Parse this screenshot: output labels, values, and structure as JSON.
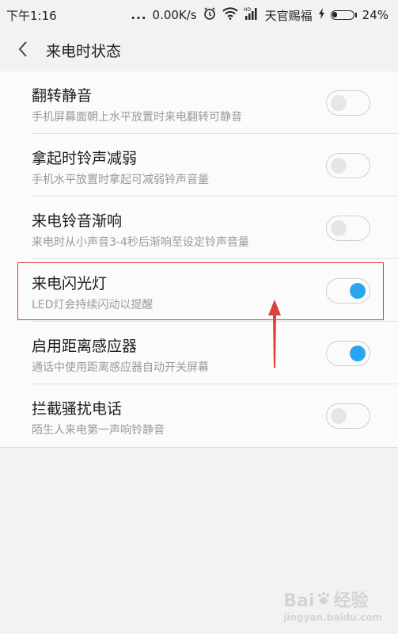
{
  "status_bar": {
    "time": "下午1:16",
    "dots": "...",
    "network_speed": "0.00K/s",
    "carrier": "天官赐福",
    "battery_percent": "24%",
    "icons": [
      "alarm-icon",
      "wifi-icon",
      "hd-signal-icon",
      "charging-icon",
      "battery-icon"
    ]
  },
  "header": {
    "title": "来电时状态",
    "back_icon": "chevron-left-icon"
  },
  "settings": [
    {
      "label": "翻转静音",
      "description": "手机屏幕面朝上水平放置时来电翻转可静音",
      "enabled": false
    },
    {
      "label": "拿起时铃声减弱",
      "description": "手机水平放置时拿起可减弱铃声音量",
      "enabled": false
    },
    {
      "label": "来电铃音渐响",
      "description": "来电时从小声音3-4秒后渐响至设定铃声音量",
      "enabled": false
    },
    {
      "label": "来电闪光灯",
      "description": "LED灯会持续闪动以提醒",
      "enabled": true
    },
    {
      "label": "启用距离感应器",
      "description": "通话中使用距离感应器自动开关屏幕",
      "enabled": true
    },
    {
      "label": "拦截骚扰电话",
      "description": "陌生人来电第一声响铃静音",
      "enabled": false
    }
  ],
  "annotation": {
    "highlight_color": "#d9413a",
    "highlighted_item": "来电闪光灯"
  },
  "colors": {
    "toggle_on": "#2aa6f0",
    "toggle_off_knob": "#e6e6e6"
  },
  "watermark": {
    "text": "Bai",
    "text2": "经验",
    "sub": "jingyan.baidu.com"
  }
}
